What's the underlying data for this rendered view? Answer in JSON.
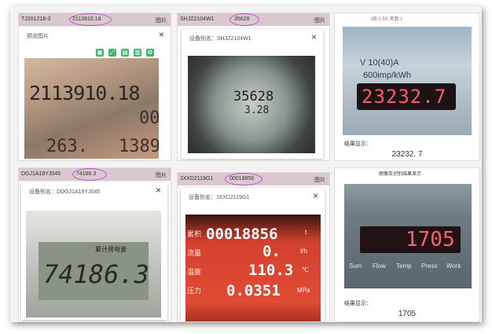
{
  "cards": [
    {
      "meter_id": "TJ201218-3",
      "reading": "2113910.18",
      "pic_label": "图片",
      "dialog_title": "预览图片",
      "close": "×",
      "display": "2113910.18",
      "display_sub": "263.",
      "display_sub2": "1389",
      "display_sub3": "00"
    },
    {
      "meter_id": "SHJZ2104W1",
      "reading": "35628",
      "pic_label": "图片",
      "dialog_title": "设备别名：SHJZ2104W1",
      "close": "×",
      "display": "35628",
      "display_sub": "3.28"
    },
    {
      "top_label": "Ⅰ级 0.5S 常数 1",
      "display_top": "V 10(40)A",
      "display_unit": "600imp/kWh",
      "display": "23232.7",
      "result_label": "结果显示：",
      "result_value": "23232. 7"
    },
    {
      "meter_id": "DGJ1A18YJ045",
      "reading": "74186.3",
      "pic_label": "图片",
      "dialog_title": "设备别名：DDGJ1A18YJ045",
      "close": "×",
      "display": "74186.3",
      "display_sub": "累计用电量"
    },
    {
      "meter_id": "JXXD2119G1",
      "reading": "00018856",
      "pic_label": "图片",
      "dialog_title": "设备别名：JXXD2119G1",
      "close": "×",
      "display": "00018856",
      "labels": [
        "累积",
        "流量",
        "温度",
        "压力"
      ],
      "rows": [
        "0.",
        "110.3",
        "0.0351"
      ],
      "units": [
        "t",
        "t/h",
        "℃",
        "MPa"
      ]
    },
    {
      "top_label": "图像及识别结果显示",
      "display": "1705",
      "buttons": [
        "Sum",
        "Flow",
        "Temp",
        "Press",
        "Work"
      ],
      "result_label": "结果显示：",
      "result_value": "1705"
    }
  ],
  "colors": {
    "header_bg": "#d9c9cf",
    "ring": "#c24bd0",
    "accent_green": "#3db36b"
  },
  "toolbar_icons": [
    "save-icon",
    "fullscreen-icon",
    "image-icon",
    "chart-icon",
    "settings-icon"
  ]
}
